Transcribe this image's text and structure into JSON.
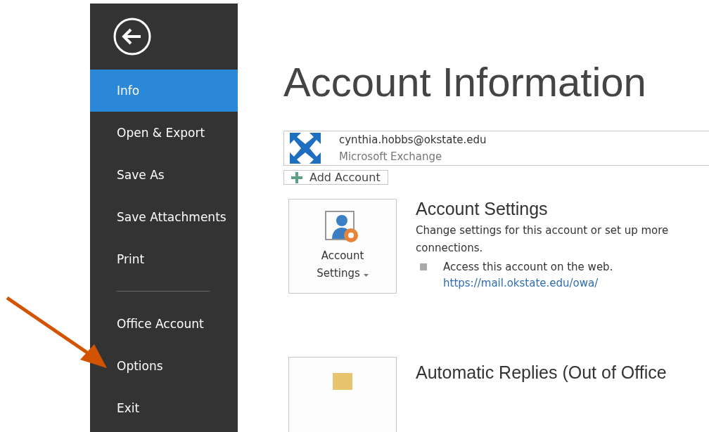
{
  "sidebar": {
    "items": [
      {
        "kind": "item",
        "label": "Info",
        "selected": true
      },
      {
        "kind": "item",
        "label": "Open & Export",
        "selected": false
      },
      {
        "kind": "item",
        "label": "Save As",
        "selected": false
      },
      {
        "kind": "item",
        "label": "Save Attachments",
        "selected": false
      },
      {
        "kind": "item",
        "label": "Print",
        "selected": false
      },
      {
        "kind": "separator"
      },
      {
        "kind": "item",
        "label": "Office Account",
        "selected": false
      },
      {
        "kind": "item",
        "label": "Options",
        "selected": false
      },
      {
        "kind": "item",
        "label": "Exit",
        "selected": false
      }
    ]
  },
  "page_title": "Account Information",
  "account": {
    "email": "cynthia.hobbs@okstate.edu",
    "type": "Microsoft Exchange"
  },
  "add_account_button": "Add Account",
  "sections": [
    {
      "kind": "settings",
      "tile_label_lines": [
        "Account",
        "Settings"
      ],
      "title": "Account Settings",
      "description": "Change settings for this account or set up more connections.",
      "bullet": "Access this account on the web.",
      "link": "https://mail.okstate.edu/owa/"
    },
    {
      "kind": "replies",
      "title": "Automatic Replies (Out of Office"
    }
  ]
}
